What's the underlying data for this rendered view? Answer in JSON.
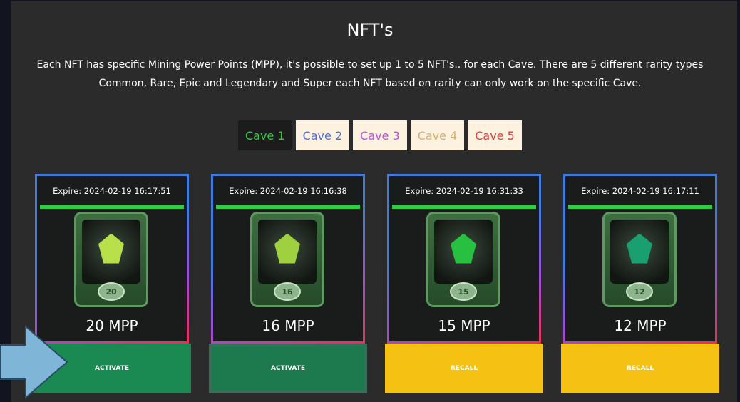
{
  "section": {
    "title": "NFT's",
    "description": "Each NFT has specific Mining Power Points (MPP), it's possible to set up 1 to 5 NFT's.. for each Cave. There are 5 different rarity types Common, Rare, Epic and Legendary and Super each NFT based on rarity can only work on the specific Cave."
  },
  "tabs": [
    {
      "label": "Cave 1",
      "bg": "#1c1c1c",
      "color": "#2ecc40"
    },
    {
      "label": "Cave 2",
      "bg": "#fdf1e0",
      "color": "#4b6be0"
    },
    {
      "label": "Cave 3",
      "bg": "#fdf1e0",
      "color": "#c04fe0"
    },
    {
      "label": "Cave 4",
      "bg": "#fdf1e0",
      "color": "#d4b070"
    },
    {
      "label": "Cave 5",
      "bg": "#fdf1e0",
      "color": "#e03b3b"
    }
  ],
  "cards": [
    {
      "expire": "Expire: 2024-02-19 16:17:51",
      "level": "20",
      "mpp": "20 MPP",
      "action": "ACTIVATE",
      "action_color": "#1a8a52",
      "gem_color": "#b8e04a"
    },
    {
      "expire": "Expire: 2024-02-19 16:16:38",
      "level": "16",
      "mpp": "16 MPP",
      "action": "ACTIVATE",
      "action_color": "#1d7a4e",
      "gem_color": "#9ed040"
    },
    {
      "expire": "Expire: 2024-02-19 16:31:33",
      "level": "15",
      "mpp": "15 MPP",
      "action": "RECALL",
      "action_color": "#f5c214",
      "gem_color": "#28c040"
    },
    {
      "expire": "Expire: 2024-02-19 16:17:11",
      "level": "12",
      "mpp": "12 MPP",
      "action": "RECALL",
      "action_color": "#f5c214",
      "gem_color": "#1aa070"
    }
  ],
  "colors": {
    "panel_bg": "#2b2b2b",
    "page_bg": "#121420",
    "progress": "#2ecc40",
    "arrow": "#7fb6d8"
  }
}
